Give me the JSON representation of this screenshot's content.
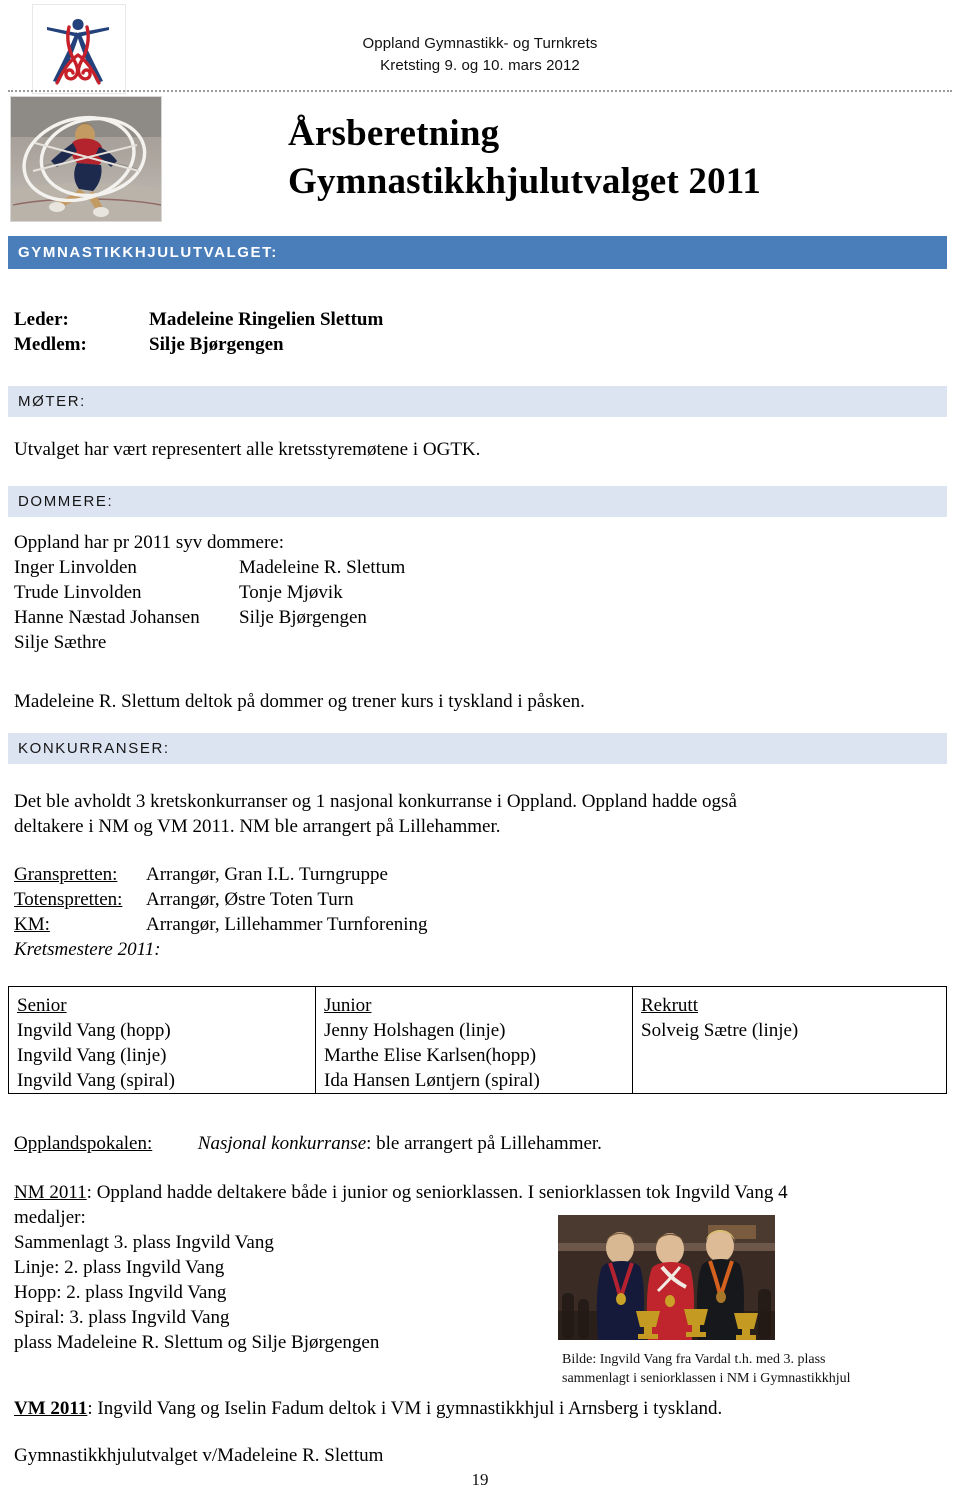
{
  "header": {
    "org_line1": "Oppland Gymnastikk- og Turnkrets",
    "org_line2": "Kretsting 9. og 10. mars 2012",
    "logo_alt": "gymnast-logo"
  },
  "title": {
    "line1": "Årsberetning",
    "line2": "Gymnastikkhjulutvalget 2011",
    "photo_alt": "gymnast-in-wheel-photo"
  },
  "sections": {
    "committee": {
      "heading": "GYMNASTIKKHJULUTVALGET:",
      "rows": [
        {
          "role": "Leder:",
          "name": "Madeleine Ringelien Slettum"
        },
        {
          "role": "Medlem:",
          "name": "Silje Bjørgengen"
        }
      ]
    },
    "meetings": {
      "heading": "MØTER:",
      "text": "Utvalget har vært representert alle  kretsstyremøtene i OGTK."
    },
    "judges": {
      "heading": "DOMMERE:",
      "intro": "Oppland har pr 2011 syv dommere:",
      "col1": [
        "Inger Linvolden",
        "Trude Linvolden",
        "Hanne Næstad Johansen",
        "Silje Sæthre"
      ],
      "col2": [
        "Madeleine R. Slettum",
        "Tonje Mjøvik",
        "Silje Bjørgengen"
      ],
      "note": "Madeleine R. Slettum deltok på dommer og trener kurs i tyskland i påsken."
    },
    "competitions": {
      "heading": "KONKURRANSER:",
      "para_line1": "Det ble avholdt 3 kretskonkurranser og 1 nasjonal konkurranse i Oppland. Oppland hadde også",
      "para_line2": "deltakere i NM og VM 2011. NM ble arrangert på Lillehammer.",
      "events": [
        {
          "name": "Granspretten: ",
          "organizer": "Arrangør, Gran I.L. Turngruppe"
        },
        {
          "name": "Totenspretten:",
          "organizer": "Arrangør, Østre Toten Turn"
        },
        {
          "name": "KM:",
          "organizer": "Arrangør, Lillehammer Turnforening"
        }
      ],
      "champions_label": "Kretsmestere 2011:"
    }
  },
  "champions_table": {
    "columns": [
      {
        "header": "Senior",
        "entries": [
          "Ingvild Vang (hopp)",
          "Ingvild Vang (linje)",
          "Ingvild Vang (spiral)"
        ]
      },
      {
        "header": "Junior",
        "entries": [
          "Jenny Holshagen (linje)",
          "Marthe Elise Karlsen(hopp)",
          "Ida Hansen Løntjern (spiral)"
        ]
      },
      {
        "header": "Rekrutt",
        "entries": [
          "Solveig Sætre (linje)"
        ]
      }
    ]
  },
  "oppland_cup": {
    "label": "Opplandspokalen:",
    "italic_part": "Nasjonal konkurranse",
    "rest": ": ble arrangert på Lillehammer."
  },
  "nm": {
    "label": "NM 2011",
    "intro_line1": ": Oppland hadde deltakere både i junior og seniorklassen. I seniorklassen tok Ingvild Vang 4",
    "intro_line2": "medaljer:",
    "results": [
      "Sammenlagt 3. plass Ingvild Vang",
      "Linje: 2. plass Ingvild Vang",
      "Hopp: 2. plass Ingvild Vang",
      "Spiral: 3. plass Ingvild Vang",
      "plass Madeleine R. Slettum og Silje Bjørgengen"
    ]
  },
  "photo_caption": {
    "line1": "Bilde: Ingvild Vang fra Vardal t.h.  med 3. plass",
    "line2": "sammenlagt i seniorklassen i NM i Gymnastikkhjul",
    "photo_alt": "three-medalists-with-trophies-photo"
  },
  "vm": {
    "label": "VM 2011",
    "text": ": Ingvild Vang og Iselin Fadum deltok i VM i gymnastikkhjul i Arnsberg i tyskland."
  },
  "signature": "Gymnastikkhjulutvalget v/Madeleine R.  Slettum",
  "page_number": "19",
  "colors": {
    "main_bar": "#4A7EBB",
    "sub_bar": "#DCE4F1",
    "logo_red": "#C8202A",
    "logo_blue": "#23417A"
  }
}
